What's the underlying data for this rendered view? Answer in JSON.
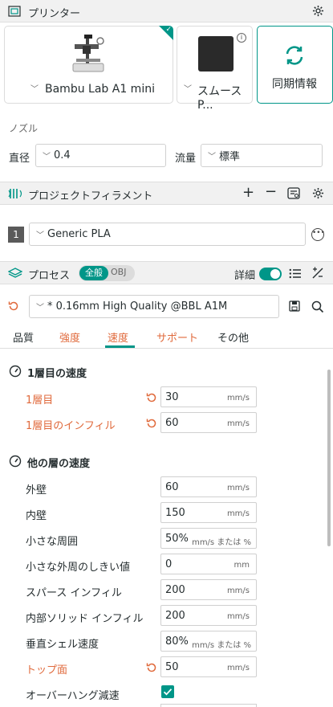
{
  "printer": {
    "title": "プリンター",
    "printer_name": "Bambu Lab A1 mini",
    "plate_name": "スムースP...",
    "sync_label": "同期情報"
  },
  "nozzle": {
    "title": "ノズル",
    "diameter_label": "直径",
    "diameter_value": "0.4",
    "flow_label": "流量",
    "flow_value": "標準"
  },
  "filament": {
    "title": "プロジェクトフィラメント",
    "slot_number": "1",
    "filament_name": "Generic PLA"
  },
  "process": {
    "title": "プロセス",
    "toggle_global": "全般",
    "toggle_obj": "OBJ",
    "detail_label": "詳細",
    "preset_name": "* 0.16mm High Quality @BBL A1M"
  },
  "tabs": [
    "品質",
    "強度",
    "速度",
    "サポート",
    "その他"
  ],
  "first_layer": {
    "title": "1層目の速度",
    "rows": [
      {
        "label": "1層目",
        "value": "30",
        "unit": "mm/s"
      },
      {
        "label": "1層目のインフィル",
        "value": "60",
        "unit": "mm/s"
      }
    ]
  },
  "other_layers": {
    "title": "他の層の速度",
    "rows": [
      {
        "label": "外壁",
        "value": "60",
        "unit": "mm/s"
      },
      {
        "label": "内壁",
        "value": "150",
        "unit": "mm/s"
      },
      {
        "label": "小さな周囲",
        "value": "50%",
        "unit": "mm/s または %"
      },
      {
        "label": "小さな外周のしきい値",
        "value": "0",
        "unit": "mm"
      },
      {
        "label": "スパース インフィル",
        "value": "200",
        "unit": "mm/s"
      },
      {
        "label": "内部ソリッド インフィル",
        "value": "200",
        "unit": "mm/s"
      },
      {
        "label": "垂直シェル速度",
        "value": "80%",
        "unit": "mm/s または %"
      },
      {
        "label": "トップ面",
        "value": "50",
        "unit": "mm/s"
      }
    ],
    "overhang_label": "オーバーハング減速"
  },
  "colors": {
    "accent": "#009688",
    "modified": "#e06a3c",
    "header_bg": "#f1f1f1"
  }
}
